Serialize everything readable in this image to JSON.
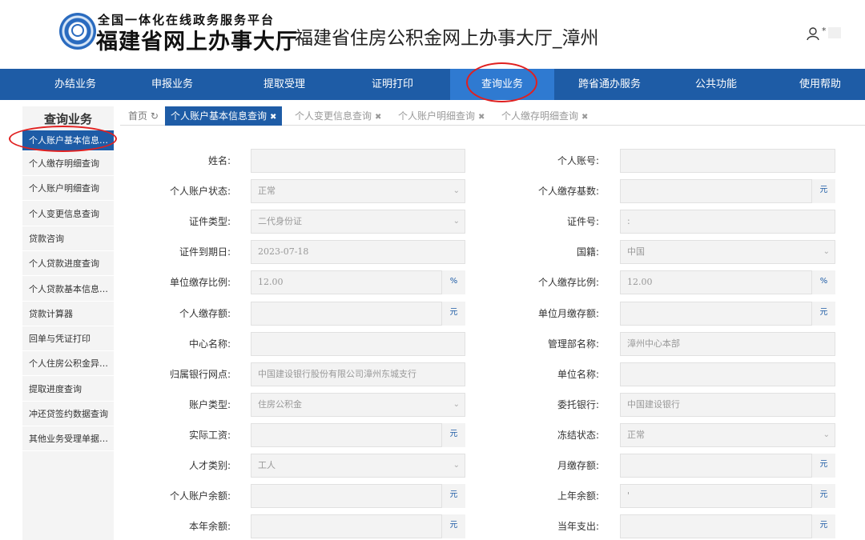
{
  "header": {
    "platform_line": "全国一体化在线政务服务平台",
    "brand": "福建省网上办事大厅",
    "site_title": "福建省住房公积金网上办事大厅_漳州",
    "user_mark": "*"
  },
  "nav": {
    "items": [
      "办结业务",
      "申报业务",
      "提取受理",
      "证明打印",
      "查询业务",
      "跨省通办服务",
      "公共功能",
      "使用帮助"
    ],
    "active_index": 4
  },
  "sidebar": {
    "title": "查询业务",
    "items": [
      "个人账户基本信息…",
      "个人缴存明细查询",
      "个人账户明细查询",
      "个人变更信息查询",
      "贷款咨询",
      "个人贷款进度查询",
      "个人贷款基本信息…",
      "贷款计算器",
      "回单与凭证打印",
      "个人住房公积金异…",
      "提取进度查询",
      "冲还贷签约数据查询",
      "其他业务受理单据…"
    ]
  },
  "tabs": {
    "home": "首页 ↻",
    "items": [
      "个人账户基本信息查询",
      "个人变更信息查询",
      "个人账户明细查询",
      "个人缴存明细查询"
    ],
    "close_glyph": "✖"
  },
  "form": {
    "rows": [
      [
        {
          "label": "姓名:",
          "value": ""
        },
        {
          "label": "个人账号:",
          "value": ""
        }
      ],
      [
        {
          "label": "个人账户状态:",
          "value": "正常",
          "select": true
        },
        {
          "label": "个人缴存基数:",
          "value": "",
          "unit": "元"
        }
      ],
      [
        {
          "label": "证件类型:",
          "value": "二代身份证",
          "select": true
        },
        {
          "label": "证件号:",
          "value": ":"
        }
      ],
      [
        {
          "label": "证件到期日:",
          "value": "2023-07-18",
          "serif": true
        },
        {
          "label": "国籍:",
          "value": "中国",
          "select": true
        }
      ],
      [
        {
          "label": "单位缴存比例:",
          "value": "12.00",
          "unit": "%",
          "serif": true
        },
        {
          "label": "个人缴存比例:",
          "value": "12.00",
          "unit": "%",
          "serif": true
        }
      ],
      [
        {
          "label": "个人缴存额:",
          "value": "",
          "unit": "元"
        },
        {
          "label": "单位月缴存额:",
          "value": "",
          "unit": "元"
        }
      ],
      [
        {
          "label": "中心名称:",
          "value": ""
        },
        {
          "label": "管理部名称:",
          "value": "漳州中心本部"
        }
      ],
      [
        {
          "label": "归属银行网点:",
          "value": "中国建设银行股份有限公司漳州东城支行"
        },
        {
          "label": "单位名称:",
          "value": ""
        }
      ],
      [
        {
          "label": "账户类型:",
          "value": "住房公积金",
          "select": true
        },
        {
          "label": "委托银行:",
          "value": "中国建设银行"
        }
      ],
      [
        {
          "label": "实际工资:",
          "value": "",
          "unit": "元"
        },
        {
          "label": "冻结状态:",
          "value": "正常",
          "select": true
        }
      ],
      [
        {
          "label": "人才类别:",
          "value": "工人",
          "select": true
        },
        {
          "label": "月缴存额:",
          "value": "",
          "unit": "元"
        }
      ],
      [
        {
          "label": "个人账户余额:",
          "value": "",
          "unit": "元"
        },
        {
          "label": "上年余额:",
          "value": "'",
          "unit": "元"
        }
      ],
      [
        {
          "label": "本年余额:",
          "value": "",
          "unit": "元"
        },
        {
          "label": "当年支出:",
          "value": "",
          "unit": "元"
        }
      ]
    ]
  },
  "colors": {
    "primary": "#1e5ca6",
    "nav_active": "#2f7ad1",
    "annotation": "#e02020"
  }
}
